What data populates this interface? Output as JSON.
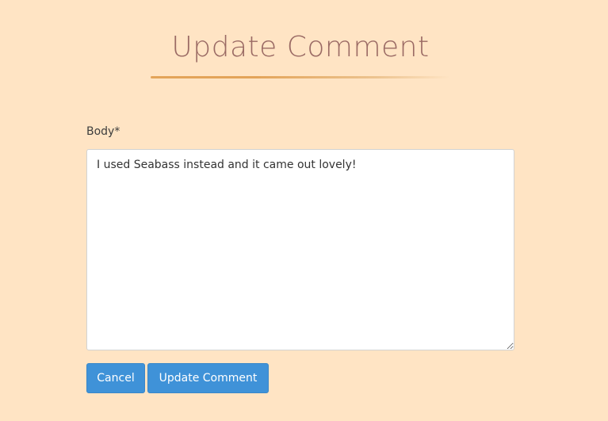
{
  "page": {
    "title": "Update Comment"
  },
  "form": {
    "body_label": "Body*",
    "body_value": "I used Seabass instead and it came out lovely!",
    "cancel_label": "Cancel",
    "submit_label": "Update Comment"
  },
  "colors": {
    "background": "#ffe4c4",
    "title": "#9a6a64",
    "accent_underline": "#e3a45a",
    "button": "#3f92d8"
  }
}
